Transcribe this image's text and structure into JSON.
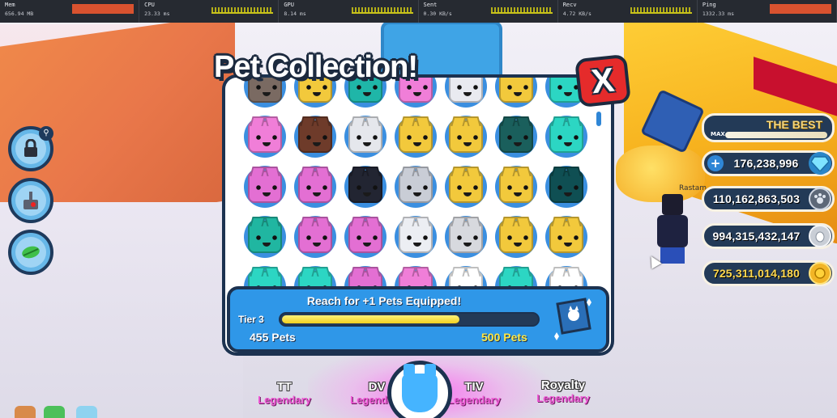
{
  "perf": [
    {
      "label": "Mem",
      "value": "656.94 MB",
      "meter": "red"
    },
    {
      "label": "CPU",
      "value": "23.33 ms",
      "meter": "spark"
    },
    {
      "label": "GPU",
      "value": "8.14 ms",
      "meter": "spark"
    },
    {
      "label": "Sent",
      "value": "0.30 KB/s",
      "meter": "spark"
    },
    {
      "label": "Recv",
      "value": "4.72 KB/s",
      "meter": "spark"
    },
    {
      "label": "Ping",
      "value": "1332.33 ms",
      "meter": "red"
    }
  ],
  "modal": {
    "title": "Pet Collection!",
    "close": "X",
    "pets": [
      [
        "#7a6a62",
        "#f2c93c",
        "#1fb6a8",
        "#f07ed8",
        "#e9eaf0",
        "#f2c93c",
        "#2cd6c3"
      ],
      [
        "#f07ed8",
        "#6e3b2a",
        "#e5e7ec",
        "#f2c93c",
        "#f2c93c",
        "#1a5f5c",
        "#2cd6c3"
      ],
      [
        "#e36fd3",
        "#e36fd3",
        "#222532",
        "#c9cdd6",
        "#f2c93c",
        "#f2c93c",
        "#0f4f53"
      ],
      [
        "#20b6a1",
        "#e36fd3",
        "#e36fd3",
        "#eceef3",
        "#d7d9de",
        "#f2c93c",
        "#f2c93c"
      ],
      [
        "#2cd6c3",
        "#2cd6c3",
        "#e36fd3",
        "#f07ed8",
        "#ffffff",
        "#2cd6c3",
        "#ffffff"
      ]
    ],
    "accent": "#3b8fe0"
  },
  "progress": {
    "heading": "Reach for +1 Pets Equipped!",
    "tier": "Tier 3",
    "current_label": "455 Pets",
    "goal_label": "500 Pets",
    "fraction": 0.69
  },
  "currency": {
    "rank_title": "THE BEST",
    "rank_max": "MAX",
    "items": [
      {
        "value": "176,238,996",
        "icon": "diamond-icon",
        "has_plus": true,
        "color": "#7ee3ff"
      },
      {
        "value": "110,162,863,503",
        "icon": "paw-coin-icon",
        "has_plus": false,
        "color": "#9aa5b5"
      },
      {
        "value": "994,315,432,147",
        "icon": "egg-coin-icon",
        "has_plus": false,
        "color": "#d5d9df"
      },
      {
        "value": "725,311,014,180",
        "icon": "gold-coin-icon",
        "has_plus": false,
        "color": "#f2b526"
      }
    ]
  },
  "player": {
    "name": "Rastam"
  },
  "bottom": [
    {
      "name": "TT",
      "tier": "Legendary"
    },
    {
      "name": "DV",
      "tier": "Legendary"
    },
    {
      "name": "TIV",
      "tier": "Legendary"
    },
    {
      "name": "Royalty",
      "tier": "Legendary"
    }
  ]
}
